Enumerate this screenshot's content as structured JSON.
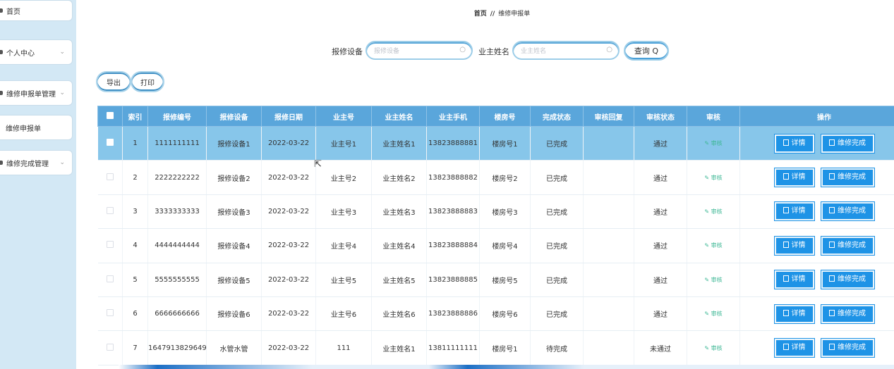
{
  "sidebar": {
    "items": [
      {
        "label": "首页",
        "chevron": ""
      },
      {
        "label": "个人中心",
        "chevron": "⌄"
      },
      {
        "label": "维修申报单管理",
        "chevron": "⌄"
      },
      {
        "label": "维修申报单",
        "chevron": ""
      },
      {
        "label": "维修完成管理",
        "chevron": "⌄"
      }
    ]
  },
  "breadcrumb": {
    "home": "首页",
    "separator": "//",
    "current": "维修申报单"
  },
  "search": {
    "device_label": "报修设备",
    "device_placeholder": "报修设备",
    "owner_label": "业主姓名",
    "owner_placeholder": "业主姓名",
    "query_label": "查询",
    "query_icon": "Q"
  },
  "actions": {
    "export_label": "导出",
    "print_label": "打印"
  },
  "table": {
    "headers": [
      "索引",
      "报修编号",
      "报修设备",
      "报修日期",
      "业主号",
      "业主姓名",
      "业主手机",
      "楼房号",
      "完成状态",
      "审核回复",
      "审核状态",
      "审核",
      "操作"
    ],
    "audit_label": "审核",
    "detail_label": "详情",
    "finish_label": "维修完成",
    "rows": [
      {
        "index": "1",
        "code": "1111111111",
        "device": "报修设备1",
        "date": "2022-03-22",
        "owner_no": "业主号1",
        "owner_name": "业主姓名1",
        "phone": "13823888881",
        "building": "楼房号1",
        "status": "已完成",
        "reply": "",
        "audit_status": "通过"
      },
      {
        "index": "2",
        "code": "2222222222",
        "device": "报修设备2",
        "date": "2022-03-22",
        "owner_no": "业主号2",
        "owner_name": "业主姓名2",
        "phone": "13823888882",
        "building": "楼房号2",
        "status": "已完成",
        "reply": "",
        "audit_status": "通过"
      },
      {
        "index": "3",
        "code": "3333333333",
        "device": "报修设备3",
        "date": "2022-03-22",
        "owner_no": "业主号3",
        "owner_name": "业主姓名3",
        "phone": "13823888883",
        "building": "楼房号3",
        "status": "已完成",
        "reply": "",
        "audit_status": "通过"
      },
      {
        "index": "4",
        "code": "4444444444",
        "device": "报修设备4",
        "date": "2022-03-22",
        "owner_no": "业主号4",
        "owner_name": "业主姓名4",
        "phone": "13823888884",
        "building": "楼房号4",
        "status": "已完成",
        "reply": "",
        "audit_status": "通过"
      },
      {
        "index": "5",
        "code": "5555555555",
        "device": "报修设备5",
        "date": "2022-03-22",
        "owner_no": "业主号5",
        "owner_name": "业主姓名5",
        "phone": "13823888885",
        "building": "楼房号5",
        "status": "已完成",
        "reply": "",
        "audit_status": "通过"
      },
      {
        "index": "6",
        "code": "6666666666",
        "device": "报修设备6",
        "date": "2022-03-22",
        "owner_no": "业主号6",
        "owner_name": "业主姓名6",
        "phone": "13823888886",
        "building": "楼房号6",
        "status": "已完成",
        "reply": "",
        "audit_status": "通过"
      },
      {
        "index": "7",
        "code": "1647913829649",
        "device": "水管水管",
        "date": "2022-03-22",
        "owner_no": "111",
        "owner_name": "业主姓名1",
        "phone": "13811111111",
        "building": "楼房号1",
        "status": "待完成",
        "reply": "",
        "audit_status": "未通过"
      }
    ]
  },
  "colors": {
    "accent": "#1e93e6",
    "header_bg": "#5aa6db",
    "selected_row": "#87c6ea",
    "sidebar_bg": "#d3e8f5",
    "audit_link": "#3fb896"
  },
  "icons": {
    "search": "search-icon",
    "audit": "edit-icon",
    "button": "document-icon",
    "chevron": "chevron-down-icon",
    "cursor": "mouse-cursor-icon"
  }
}
